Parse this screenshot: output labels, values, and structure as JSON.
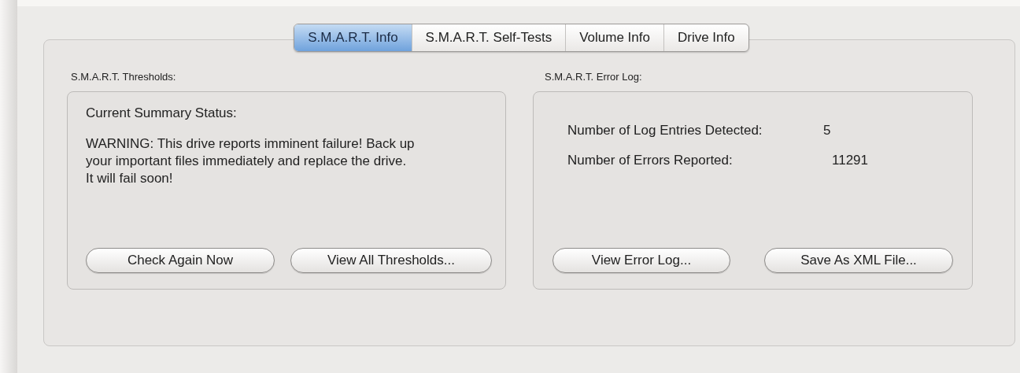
{
  "tabs": [
    {
      "label": "S.M.A.R.T. Info",
      "selected": true
    },
    {
      "label": "S.M.A.R.T. Self-Tests",
      "selected": false
    },
    {
      "label": "Volume Info",
      "selected": false
    },
    {
      "label": "Drive Info",
      "selected": false
    }
  ],
  "thresholds": {
    "title": "S.M.A.R.T. Thresholds:",
    "status_label": "Current Summary Status:",
    "message": "WARNING: This drive reports imminent failure! Back up your important files immediately and replace the drive. It will fail soon!",
    "buttons": [
      "Check Again Now",
      "View All Thresholds..."
    ]
  },
  "error_log": {
    "title": "S.M.A.R.T. Error Log:",
    "rows": [
      {
        "label": "Number of Log Entries Detected:",
        "value": "5"
      },
      {
        "label": "Number of Errors Reported:",
        "value": "11291"
      }
    ],
    "buttons": [
      "View Error Log...",
      "Save As XML File..."
    ]
  }
}
